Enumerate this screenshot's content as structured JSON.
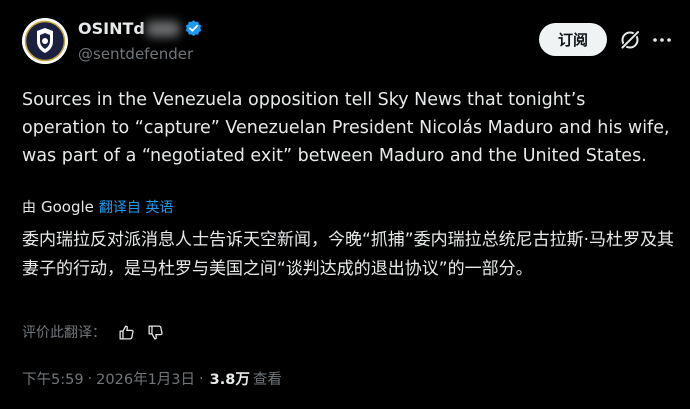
{
  "header": {
    "display_name": "OSINTd",
    "handle": "@sentdefender",
    "subscribe_label": "订阅"
  },
  "post": {
    "text": "Sources in the Venezuela opposition tell Sky News that tonight’s operation to “capture” Venezuelan President Nicolás Maduro and his wife, was part of a “negotiated exit” between Maduro and the United States."
  },
  "translation": {
    "by_prefix": "由",
    "provider": "Google",
    "link_label": "翻译自 英语",
    "text": "委内瑞拉反对派消息人士告诉天空新闻，今晚“抓捕”委内瑞拉总统尼古拉斯·马杜罗及其妻子的行动，是马杜罗与美国之间“谈判达成的退出协议”的一部分。",
    "rate_label": "评价此翻译："
  },
  "meta": {
    "time": "下午5:59",
    "separator": "·",
    "date": "2026年1月3日",
    "views_count": "3.8万",
    "views_label": "查看"
  },
  "icons": {
    "verified": "verified-badge-icon",
    "grok": "grok-icon",
    "more": "more-options-icon",
    "thumbs_up": "thumbs-up-icon",
    "thumbs_down": "thumbs-down-icon"
  },
  "colors": {
    "background": "#000000",
    "text_primary": "#e7e9ea",
    "text_secondary": "#71767b",
    "accent": "#1d9bf0",
    "button_bg": "#eff3f4"
  }
}
